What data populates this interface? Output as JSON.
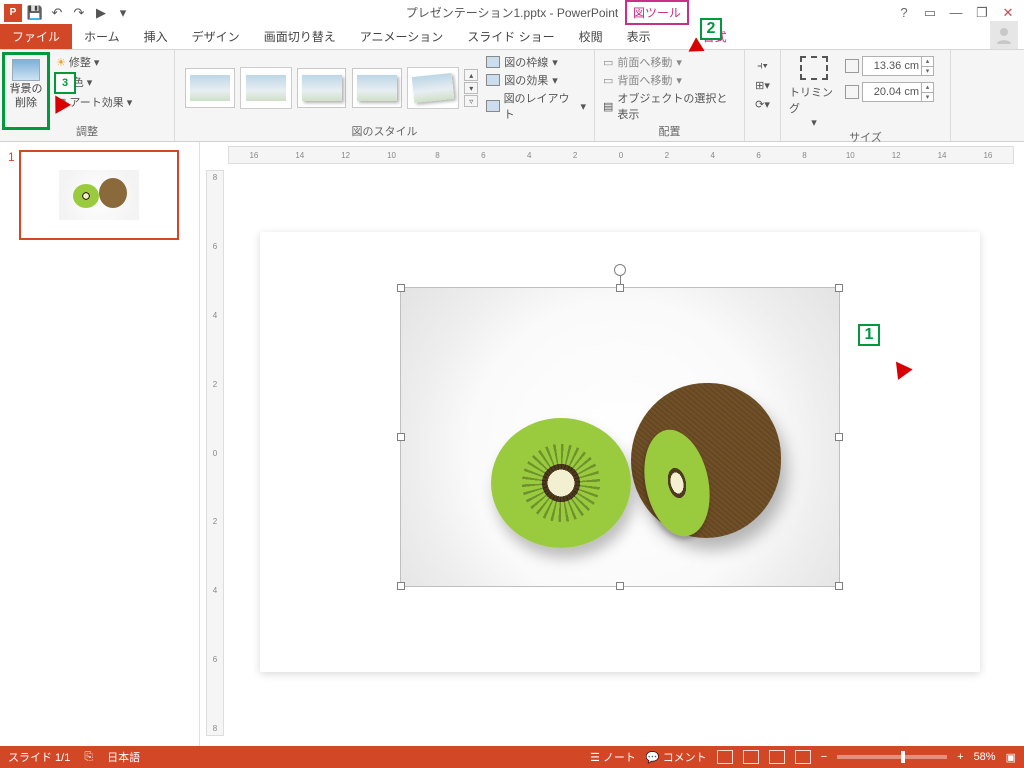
{
  "app": {
    "title": "プレゼンテーション1.pptx - PowerPoint",
    "icon_label": "P"
  },
  "qat": {
    "save": "💾",
    "undo": "↶",
    "redo": "↷",
    "start": "▶",
    "more": "▾"
  },
  "contextual_tab": {
    "group": "図ツール",
    "tab": "書式"
  },
  "tabs": {
    "file": "ファイル",
    "home": "ホーム",
    "insert": "挿入",
    "design": "デザイン",
    "transitions": "画面切り替え",
    "animations": "アニメーション",
    "slideshow": "スライド ショー",
    "review": "校閲",
    "view": "表示"
  },
  "window_controls": {
    "help": "?",
    "ribbon_opts": "▭",
    "min": "—",
    "restore": "❐",
    "close": "✕"
  },
  "ribbon": {
    "remove_bg": {
      "line1": "背景の",
      "line2": "削除"
    },
    "adjust": {
      "corrections": "修整",
      "color": "色",
      "artistic": "アート効果",
      "label": "調整"
    },
    "styles": {
      "border": "図の枠線",
      "effects": "図の効果",
      "layout": "図のレイアウト",
      "label": "図のスタイル"
    },
    "arrange": {
      "front": "前面へ移動",
      "back": "背面へ移動",
      "selpane": "オブジェクトの選択と表示",
      "label": "配置"
    },
    "size": {
      "trim": "トリミング",
      "height": "13.36 cm",
      "width": "20.04 cm",
      "label": "サイズ"
    }
  },
  "callouts": {
    "c1": "1",
    "c2": "2",
    "c3": "3"
  },
  "slide_panel": {
    "num": "1"
  },
  "ruler": {
    "h": [
      "16",
      "14",
      "12",
      "10",
      "8",
      "6",
      "4",
      "2",
      "0",
      "2",
      "4",
      "6",
      "8",
      "10",
      "12",
      "14",
      "16"
    ],
    "v": [
      "8",
      "6",
      "4",
      "2",
      "0",
      "2",
      "4",
      "6",
      "8"
    ]
  },
  "status": {
    "slide": "スライド 1/1",
    "lang_icon": "⎘",
    "lang": "日本語",
    "notes": "ノート",
    "comments": "コメント",
    "zoom": "58%",
    "fit": "▣"
  }
}
